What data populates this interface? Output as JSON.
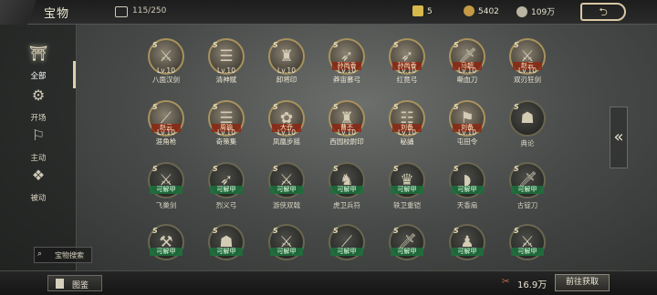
{
  "header": {
    "title": "宝物",
    "capacity": "115/250",
    "resources": [
      {
        "icon": "lightning-ticket-icon",
        "value": "5"
      },
      {
        "icon": "copper-coin-icon",
        "value": "5402"
      },
      {
        "icon": "silver-coin-icon",
        "value": "109万"
      }
    ]
  },
  "sidebar": {
    "tabs": [
      {
        "label": "全部",
        "icon": "all-treasure-icon",
        "glyph": "⛩"
      },
      {
        "label": "开场",
        "icon": "opening-icon",
        "glyph": "⚙"
      },
      {
        "label": "主动",
        "icon": "active-skill-icon",
        "glyph": "⚐"
      },
      {
        "label": "被动",
        "icon": "passive-skill-icon",
        "glyph": "❖"
      }
    ],
    "search_label": "宝物搜索"
  },
  "items": [
    {
      "rank": "S",
      "level": "Lv.10",
      "name": "八面汉剑",
      "glyph": "⚔",
      "icon": "sword-icon"
    },
    {
      "rank": "S",
      "level": "Lv.10",
      "name": "清神赋",
      "glyph": "☰",
      "icon": "scroll-icon"
    },
    {
      "rank": "S",
      "level": "Lv.10",
      "name": "卸将印",
      "glyph": "♜",
      "icon": "seal-icon"
    },
    {
      "rank": "S",
      "tag": "孙尚香",
      "level": "Lv.10",
      "name": "莽宙慕弓",
      "glyph": "➶",
      "icon": "bow-icon"
    },
    {
      "rank": "S",
      "tag": "孙尚香",
      "level": "Lv.10",
      "name": "红竟弓",
      "glyph": "➶",
      "icon": "bow-icon"
    },
    {
      "rank": "S",
      "tag": "马超",
      "level": "Lv.10",
      "name": "嘶血刀",
      "glyph": "🗡",
      "icon": "blade-icon"
    },
    {
      "rank": "S",
      "tag": "赵云",
      "level": "Lv.10",
      "name": "双刃狂剑",
      "glyph": "⚔",
      "icon": "twin-sword-icon"
    },
    {
      "rank": "S",
      "tag": "赵云",
      "level": "Lv.10",
      "name": "涯角枪",
      "glyph": "⟋",
      "icon": "spear-icon"
    },
    {
      "rank": "S",
      "tag": "周瑜",
      "level": "Lv.10",
      "name": "奇策集",
      "glyph": "☰",
      "icon": "book-icon"
    },
    {
      "rank": "S",
      "tag": "大乔",
      "level": "Lv.10",
      "name": "凤凰步摇",
      "glyph": "✿",
      "icon": "hairpin-icon"
    },
    {
      "rank": "S",
      "tag": "曹丕",
      "level": "Lv.10",
      "name": "西园校尉印",
      "glyph": "♜",
      "icon": "seal-icon"
    },
    {
      "rank": "S",
      "tag": "刘备",
      "level": "Lv.10",
      "name": "秘誦",
      "glyph": "☷",
      "icon": "scroll-case-icon"
    },
    {
      "rank": "S",
      "tag": "刘备",
      "level": "Lv.10",
      "name": "屯田令",
      "glyph": "⚑",
      "icon": "decree-icon"
    },
    {
      "rank": "S",
      "name": "典论",
      "glyph": "☗",
      "icon": "tome-icon",
      "locked": true
    },
    {
      "rank": "S",
      "unlock": "可解甲",
      "name": "飞巢剑",
      "glyph": "⚔",
      "icon": "sword-icon",
      "locked": true
    },
    {
      "rank": "S",
      "unlock": "可解甲",
      "name": "烈义弓",
      "glyph": "➶",
      "icon": "bow-icon",
      "locked": true
    },
    {
      "rank": "S",
      "unlock": "可解甲",
      "name": "游侠双戟",
      "glyph": "⚔",
      "icon": "halberd-icon",
      "locked": true
    },
    {
      "rank": "S",
      "unlock": "可解甲",
      "name": "虎卫兵符",
      "glyph": "♞",
      "icon": "tally-icon",
      "locked": true
    },
    {
      "rank": "S",
      "unlock": "可解甲",
      "name": "轶卫重铠",
      "glyph": "♛",
      "icon": "armor-icon",
      "locked": true
    },
    {
      "rank": "S",
      "unlock": "可解甲",
      "name": "天香扇",
      "glyph": "◗",
      "icon": "fan-icon",
      "locked": true
    },
    {
      "rank": "S",
      "unlock": "可解甲",
      "name": "古锭刀",
      "glyph": "🗡",
      "icon": "blade-icon",
      "locked": true
    },
    {
      "rank": "S",
      "unlock": "可解甲",
      "name": "",
      "glyph": "⚒",
      "icon": "axe-icon",
      "locked": true
    },
    {
      "rank": "S",
      "unlock": "可解甲",
      "name": "",
      "glyph": "☗",
      "icon": "helmet-icon",
      "locked": true
    },
    {
      "rank": "S",
      "unlock": "可解甲",
      "name": "",
      "glyph": "⚔",
      "icon": "sword-icon",
      "locked": true
    },
    {
      "rank": "S",
      "unlock": "可解甲",
      "name": "",
      "glyph": "⟋",
      "icon": "spear-icon",
      "locked": true
    },
    {
      "rank": "S",
      "unlock": "可解甲",
      "name": "",
      "glyph": "🗡",
      "icon": "blade-icon",
      "locked": true
    },
    {
      "rank": "S",
      "unlock": "可解甲",
      "name": "",
      "glyph": "♟",
      "icon": "figure-icon",
      "locked": true
    },
    {
      "rank": "S",
      "unlock": "可解甲",
      "name": "",
      "glyph": "⚔",
      "icon": "sword-icon",
      "locked": true
    }
  ],
  "footer": {
    "atlas_label": "图鉴",
    "money": "16.9万",
    "goto_label": "前往获取"
  },
  "arrow_glyph": "«",
  "menu_glyph": "⮌"
}
